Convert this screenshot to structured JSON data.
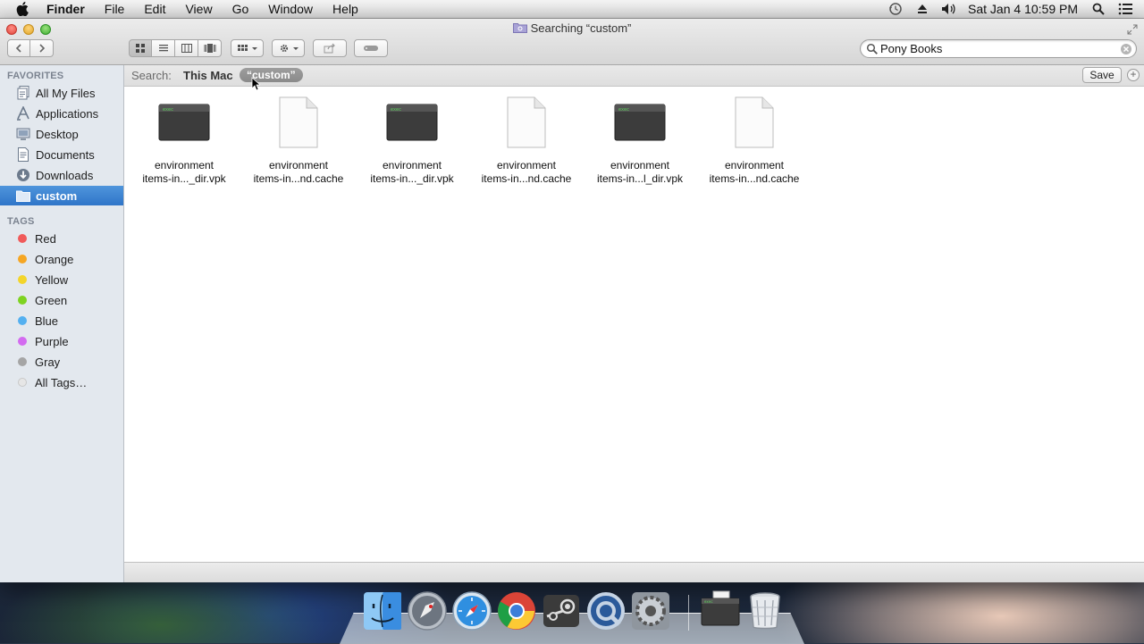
{
  "menubar": {
    "app_name": "Finder",
    "items": [
      "File",
      "Edit",
      "View",
      "Go",
      "Window",
      "Help"
    ],
    "clock": "Sat Jan 4  10:59 PM"
  },
  "window": {
    "title": "Searching “custom”"
  },
  "toolbar": {
    "search_value": "Pony Books"
  },
  "sidebar": {
    "favorites_header": "FAVORITES",
    "favorites": [
      {
        "label": "All My Files",
        "icon": "all-my-files-icon"
      },
      {
        "label": "Applications",
        "icon": "applications-icon"
      },
      {
        "label": "Desktop",
        "icon": "desktop-icon"
      },
      {
        "label": "Documents",
        "icon": "documents-icon"
      },
      {
        "label": "Downloads",
        "icon": "downloads-icon"
      },
      {
        "label": "custom",
        "icon": "folder-icon",
        "selected": true
      }
    ],
    "tags_header": "TAGS",
    "tags": [
      {
        "label": "Red",
        "color": "#f05a5a"
      },
      {
        "label": "Orange",
        "color": "#f5a623"
      },
      {
        "label": "Yellow",
        "color": "#f3d52b"
      },
      {
        "label": "Green",
        "color": "#7ed321"
      },
      {
        "label": "Blue",
        "color": "#54b0f0"
      },
      {
        "label": "Purple",
        "color": "#d36bf0"
      },
      {
        "label": "Gray",
        "color": "#a5a5a5"
      },
      {
        "label": "All Tags…",
        "color": "#d8d8d8"
      }
    ]
  },
  "scopebar": {
    "label": "Search:",
    "this_mac": "This Mac",
    "token": "“custom”",
    "save_label": "Save",
    "add_label": "+"
  },
  "files": [
    {
      "line1": "environment",
      "line2": "items-in..._dir.vpk",
      "kind": "exec"
    },
    {
      "line1": "environment",
      "line2": "items-in...nd.cache",
      "kind": "document"
    },
    {
      "line1": "environment",
      "line2": "items-in..._dir.vpk",
      "kind": "exec"
    },
    {
      "line1": "environment",
      "line2": "items-in...nd.cache",
      "kind": "document"
    },
    {
      "line1": "environment",
      "line2": "items-in...l_dir.vpk",
      "kind": "exec"
    },
    {
      "line1": "environment",
      "line2": "items-in...nd.cache",
      "kind": "document"
    }
  ],
  "dock": [
    "finder-icon",
    "launchpad-icon",
    "safari-icon",
    "chrome-icon",
    "steam-icon",
    "quicktime-icon",
    "system-preferences-icon",
    "exec-file-icon",
    "trash-icon"
  ]
}
